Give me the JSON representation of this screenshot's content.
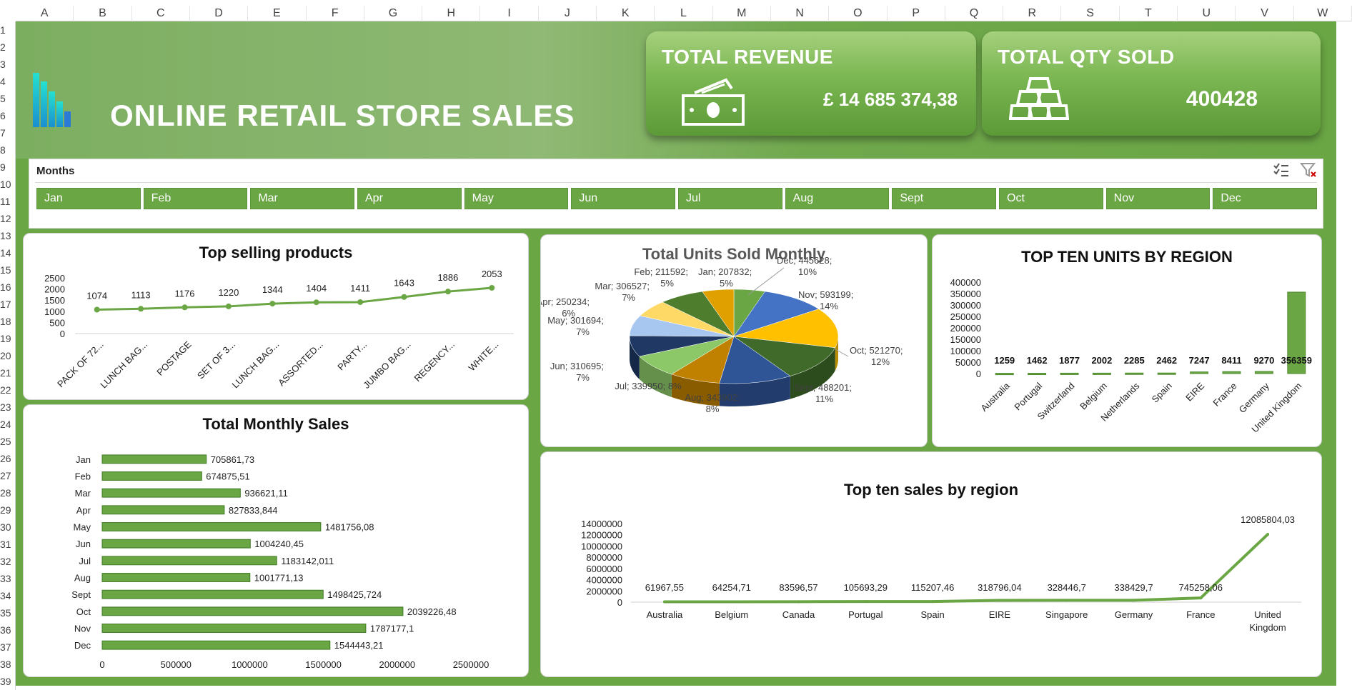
{
  "sheet": {
    "columns": [
      "A",
      "B",
      "C",
      "D",
      "E",
      "F",
      "G",
      "H",
      "I",
      "J",
      "K",
      "L",
      "M",
      "N",
      "O",
      "P",
      "Q",
      "R",
      "S",
      "T",
      "U",
      "V",
      "W"
    ],
    "rows": [
      "1",
      "2",
      "3",
      "4",
      "5",
      "6",
      "7",
      "8",
      "9",
      "10",
      "11",
      "12",
      "13",
      "14",
      "15",
      "16",
      "17",
      "18",
      "19",
      "20",
      "21",
      "22",
      "23",
      "24",
      "25",
      "26",
      "27",
      "28",
      "29",
      "30",
      "31",
      "32",
      "33",
      "34",
      "35",
      "36",
      "37",
      "38",
      "39"
    ]
  },
  "header": {
    "title": "ONLINE RETAIL STORE SALES"
  },
  "kpis": [
    {
      "title": "TOTAL REVENUE",
      "value": "£  14 685 374,38",
      "icon": "money-icon"
    },
    {
      "title": "TOTAL QTY SOLD",
      "value": "400428",
      "icon": "gold-bars-icon"
    }
  ],
  "slicer": {
    "title": "Months",
    "items": [
      "Jan",
      "Feb",
      "Mar",
      "Apr",
      "May",
      "Jun",
      "Jul",
      "Aug",
      "Sept",
      "Oct",
      "Nov",
      "Dec"
    ]
  },
  "colors": {
    "green": "#6aa644",
    "line_green": "#6aa644",
    "pie": [
      "#6aa644",
      "#4472c4",
      "#ffc000",
      "#3f6a2a",
      "#2f5597",
      "#c08000",
      "#8cc868",
      "#1f3864",
      "#a7c7f0",
      "#ffd966",
      "#4d7d2d",
      "#e0a000"
    ]
  },
  "chart_data": [
    {
      "id": "top-selling-products",
      "type": "line",
      "title": "Top selling products",
      "categories": [
        "PACK OF 72...",
        "LUNCH BAG...",
        "POSTAGE",
        "SET OF 3...",
        "LUNCH BAG...",
        "ASSORTED...",
        "PARTY...",
        "JUMBO BAG...",
        "REGENCY...",
        "WHITE..."
      ],
      "values": [
        1074,
        1113,
        1176,
        1220,
        1344,
        1404,
        1411,
        1643,
        1886,
        2053
      ],
      "yticks": [
        "0",
        "500",
        "1000",
        "1500",
        "2000",
        "2500"
      ],
      "ylim": [
        0,
        2500
      ]
    },
    {
      "id": "total-units-sold-monthly",
      "type": "pie",
      "title": "Total Units Sold Monthly",
      "slices": [
        {
          "label": "Jan; 207832;",
          "pct": "5%",
          "value": 207832
        },
        {
          "label": "Dec; 445628;",
          "pct": "10%",
          "value": 445628
        },
        {
          "label": "Nov; 593199;",
          "pct": "14%",
          "value": 593199
        },
        {
          "label": "Oct; 521270;",
          "pct": "12%",
          "value": 521270
        },
        {
          "label": "Sept; 488201;",
          "pct": "11%",
          "value": 488201
        },
        {
          "label": "Aug; 343902;",
          "pct": "8%",
          "value": 343902
        },
        {
          "label": "Jul; 339950; 8%",
          "pct": "",
          "value": 339950
        },
        {
          "label": "Jun; 310695;",
          "pct": "7%",
          "value": 310695
        },
        {
          "label": "May; 301694;",
          "pct": "7%",
          "value": 301694
        },
        {
          "label": "Apr; 250234;",
          "pct": "6%",
          "value": 250234
        },
        {
          "label": "Mar; 306527;",
          "pct": "7%",
          "value": 306527
        },
        {
          "label": "Feb; 211592;",
          "pct": "5%",
          "value": 211592
        }
      ]
    },
    {
      "id": "top-ten-units-by-region",
      "type": "bar",
      "title": "TOP TEN UNITS BY REGION",
      "categories": [
        "Australia",
        "Portugal",
        "Switzerland",
        "Belgium",
        "Netherlands",
        "Spain",
        "EIRE",
        "France",
        "Germany",
        "United Kingdom"
      ],
      "values": [
        1259,
        1462,
        1877,
        2002,
        2285,
        2462,
        7247,
        8411,
        9270,
        356359
      ],
      "yticks": [
        "0",
        "50000",
        "100000",
        "150000",
        "200000",
        "250000",
        "300000",
        "350000",
        "400000"
      ],
      "ylim": [
        0,
        400000
      ]
    },
    {
      "id": "total-monthly-sales",
      "type": "bar",
      "title": "Total Monthly Sales",
      "categories": [
        "Jan",
        "Feb",
        "Mar",
        "Apr",
        "May",
        "Jun",
        "Jul",
        "Aug",
        "Sept",
        "Oct",
        "Nov",
        "Dec"
      ],
      "values": [
        705861.73,
        674875.51,
        936621.11,
        827833.844,
        1481756.08,
        1004240.45,
        1183142.011,
        1001771.13,
        1498425.724,
        2039226.48,
        1787177.1,
        1544443.21
      ],
      "labels": [
        "705861,73",
        "674875,51",
        "936621,11",
        "827833,844",
        "1481756,08",
        "1004240,45",
        "1183142,011",
        "1001771,13",
        "1498425,724",
        "2039226,48",
        "1787177,1",
        "1544443,21"
      ],
      "xticks": [
        "0",
        "500000",
        "1000000",
        "1500000",
        "2000000",
        "2500000"
      ],
      "xlim": [
        0,
        2500000
      ]
    },
    {
      "id": "top-ten-sales-by-region",
      "type": "line",
      "title": "Top ten sales by region",
      "categories": [
        "Australia",
        "Belgium",
        "Canada",
        "Portugal",
        "Spain",
        "EIRE",
        "Singapore",
        "Germany",
        "France",
        "United Kingdom"
      ],
      "values": [
        61967.55,
        64254.71,
        83596.57,
        105693.29,
        115207.46,
        318796.04,
        328446.7,
        338429.7,
        745258.06,
        12085804.03
      ],
      "labels": [
        "61967,55",
        "64254,71",
        "83596,57",
        "105693,29",
        "115207,46",
        "318796,04",
        "328446,7",
        "338429,7",
        "745258,06",
        "12085804,03"
      ],
      "yticks": [
        "0",
        "2000000",
        "4000000",
        "6000000",
        "8000000",
        "10000000",
        "12000000",
        "14000000"
      ],
      "ylim": [
        0,
        14000000
      ]
    }
  ]
}
